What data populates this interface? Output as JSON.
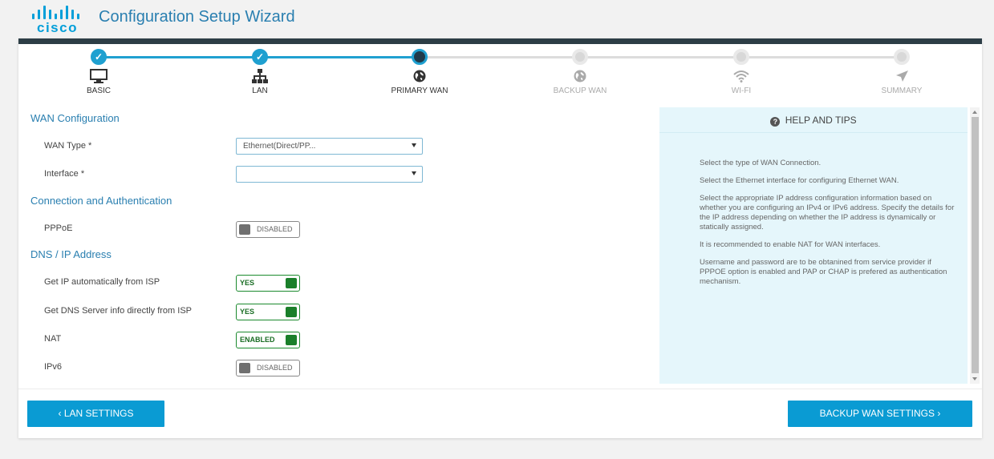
{
  "header": {
    "logo_text": "cisco",
    "title": "Configuration Setup Wizard"
  },
  "stepper": {
    "steps": [
      {
        "label": "BASIC",
        "state": "done",
        "icon": "monitor-icon"
      },
      {
        "label": "LAN",
        "state": "done",
        "icon": "network-icon"
      },
      {
        "label": "PRIMARY WAN",
        "state": "current",
        "icon": "globe-icon"
      },
      {
        "label": "BACKUP WAN",
        "state": "pending",
        "icon": "globe-icon"
      },
      {
        "label": "WI-FI",
        "state": "pending",
        "icon": "wifi-icon"
      },
      {
        "label": "SUMMARY",
        "state": "pending",
        "icon": "send-icon"
      }
    ],
    "check_glyph": "✓"
  },
  "wan_config": {
    "title": "WAN Configuration",
    "wan_type_label": "WAN Type *",
    "wan_type_value": "Ethernet(Direct/PP...",
    "interface_label": "Interface *",
    "interface_value": ""
  },
  "connection": {
    "title": "Connection and Authentication",
    "pppoe_label": "PPPoE",
    "pppoe_state": "DISABLED"
  },
  "dns": {
    "title": "DNS / IP Address",
    "get_ip_label": "Get IP automatically from ISP",
    "get_ip_state": "YES",
    "get_dns_label": "Get DNS Server info directly from ISP",
    "get_dns_state": "YES",
    "nat_label": "NAT",
    "nat_state": "ENABLED",
    "ipv6_label": "IPv6",
    "ipv6_state": "DISABLED"
  },
  "help": {
    "title": "HELP AND TIPS",
    "icon": "question-circle-icon",
    "tips": [
      "Select the type of WAN Connection.",
      "Select the Ethernet interface for configuring Ethernet WAN.",
      "Select the appropriate IP address configuration information based on whether you are configuring an IPv4 or IPv6 address. Specify the details for the IP address depending on whether the IP address is dynamically or statically assigned.",
      "It is recommended to enable NAT for WAN interfaces.",
      "Username and password are to be obtanined from service provider if PPPOE option is enabled and PAP or CHAP is prefered as authentication mechanism."
    ]
  },
  "footer": {
    "prev_label": "‹ LAN SETTINGS",
    "next_label": "BACKUP WAN SETTINGS ›"
  },
  "colors": {
    "brand": "#049fd9",
    "accent": "#0a9bd3",
    "header_bar": "#2d3e46",
    "toggle_on": "#1a7f2a",
    "help_bg": "#e5f6fb"
  }
}
